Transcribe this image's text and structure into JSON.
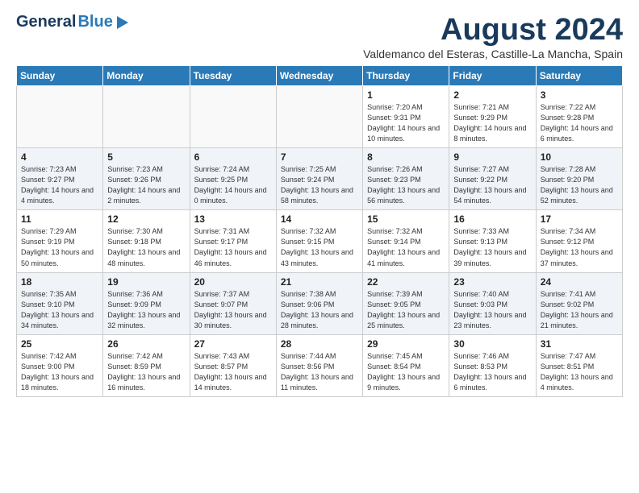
{
  "header": {
    "logo_general": "General",
    "logo_blue": "Blue",
    "title": "August 2024",
    "location": "Valdemanco del Esteras, Castille-La Mancha, Spain"
  },
  "weekdays": [
    "Sunday",
    "Monday",
    "Tuesday",
    "Wednesday",
    "Thursday",
    "Friday",
    "Saturday"
  ],
  "weeks": [
    [
      {
        "day": "",
        "info": ""
      },
      {
        "day": "",
        "info": ""
      },
      {
        "day": "",
        "info": ""
      },
      {
        "day": "",
        "info": ""
      },
      {
        "day": "1",
        "info": "Sunrise: 7:20 AM\nSunset: 9:31 PM\nDaylight: 14 hours\nand 10 minutes."
      },
      {
        "day": "2",
        "info": "Sunrise: 7:21 AM\nSunset: 9:29 PM\nDaylight: 14 hours\nand 8 minutes."
      },
      {
        "day": "3",
        "info": "Sunrise: 7:22 AM\nSunset: 9:28 PM\nDaylight: 14 hours\nand 6 minutes."
      }
    ],
    [
      {
        "day": "4",
        "info": "Sunrise: 7:23 AM\nSunset: 9:27 PM\nDaylight: 14 hours\nand 4 minutes."
      },
      {
        "day": "5",
        "info": "Sunrise: 7:23 AM\nSunset: 9:26 PM\nDaylight: 14 hours\nand 2 minutes."
      },
      {
        "day": "6",
        "info": "Sunrise: 7:24 AM\nSunset: 9:25 PM\nDaylight: 14 hours\nand 0 minutes."
      },
      {
        "day": "7",
        "info": "Sunrise: 7:25 AM\nSunset: 9:24 PM\nDaylight: 13 hours\nand 58 minutes."
      },
      {
        "day": "8",
        "info": "Sunrise: 7:26 AM\nSunset: 9:23 PM\nDaylight: 13 hours\nand 56 minutes."
      },
      {
        "day": "9",
        "info": "Sunrise: 7:27 AM\nSunset: 9:22 PM\nDaylight: 13 hours\nand 54 minutes."
      },
      {
        "day": "10",
        "info": "Sunrise: 7:28 AM\nSunset: 9:20 PM\nDaylight: 13 hours\nand 52 minutes."
      }
    ],
    [
      {
        "day": "11",
        "info": "Sunrise: 7:29 AM\nSunset: 9:19 PM\nDaylight: 13 hours\nand 50 minutes."
      },
      {
        "day": "12",
        "info": "Sunrise: 7:30 AM\nSunset: 9:18 PM\nDaylight: 13 hours\nand 48 minutes."
      },
      {
        "day": "13",
        "info": "Sunrise: 7:31 AM\nSunset: 9:17 PM\nDaylight: 13 hours\nand 46 minutes."
      },
      {
        "day": "14",
        "info": "Sunrise: 7:32 AM\nSunset: 9:15 PM\nDaylight: 13 hours\nand 43 minutes."
      },
      {
        "day": "15",
        "info": "Sunrise: 7:32 AM\nSunset: 9:14 PM\nDaylight: 13 hours\nand 41 minutes."
      },
      {
        "day": "16",
        "info": "Sunrise: 7:33 AM\nSunset: 9:13 PM\nDaylight: 13 hours\nand 39 minutes."
      },
      {
        "day": "17",
        "info": "Sunrise: 7:34 AM\nSunset: 9:12 PM\nDaylight: 13 hours\nand 37 minutes."
      }
    ],
    [
      {
        "day": "18",
        "info": "Sunrise: 7:35 AM\nSunset: 9:10 PM\nDaylight: 13 hours\nand 34 minutes."
      },
      {
        "day": "19",
        "info": "Sunrise: 7:36 AM\nSunset: 9:09 PM\nDaylight: 13 hours\nand 32 minutes."
      },
      {
        "day": "20",
        "info": "Sunrise: 7:37 AM\nSunset: 9:07 PM\nDaylight: 13 hours\nand 30 minutes."
      },
      {
        "day": "21",
        "info": "Sunrise: 7:38 AM\nSunset: 9:06 PM\nDaylight: 13 hours\nand 28 minutes."
      },
      {
        "day": "22",
        "info": "Sunrise: 7:39 AM\nSunset: 9:05 PM\nDaylight: 13 hours\nand 25 minutes."
      },
      {
        "day": "23",
        "info": "Sunrise: 7:40 AM\nSunset: 9:03 PM\nDaylight: 13 hours\nand 23 minutes."
      },
      {
        "day": "24",
        "info": "Sunrise: 7:41 AM\nSunset: 9:02 PM\nDaylight: 13 hours\nand 21 minutes."
      }
    ],
    [
      {
        "day": "25",
        "info": "Sunrise: 7:42 AM\nSunset: 9:00 PM\nDaylight: 13 hours\nand 18 minutes."
      },
      {
        "day": "26",
        "info": "Sunrise: 7:42 AM\nSunset: 8:59 PM\nDaylight: 13 hours\nand 16 minutes."
      },
      {
        "day": "27",
        "info": "Sunrise: 7:43 AM\nSunset: 8:57 PM\nDaylight: 13 hours\nand 14 minutes."
      },
      {
        "day": "28",
        "info": "Sunrise: 7:44 AM\nSunset: 8:56 PM\nDaylight: 13 hours\nand 11 minutes."
      },
      {
        "day": "29",
        "info": "Sunrise: 7:45 AM\nSunset: 8:54 PM\nDaylight: 13 hours\nand 9 minutes."
      },
      {
        "day": "30",
        "info": "Sunrise: 7:46 AM\nSunset: 8:53 PM\nDaylight: 13 hours\nand 6 minutes."
      },
      {
        "day": "31",
        "info": "Sunrise: 7:47 AM\nSunset: 8:51 PM\nDaylight: 13 hours\nand 4 minutes."
      }
    ]
  ]
}
